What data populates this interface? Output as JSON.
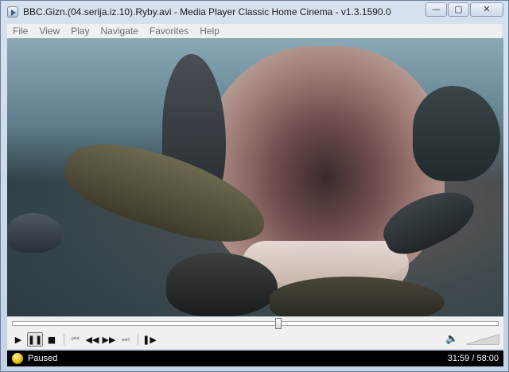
{
  "window": {
    "title": "BBC.Gizn.(04.serija.iz.10).Ryby.avi - Media Player Classic Home Cinema - v1.3.1590.0",
    "buttons": {
      "minimize": "—",
      "maximize": "▢",
      "close": "✕"
    }
  },
  "menu": {
    "items": [
      "File",
      "View",
      "Play",
      "Navigate",
      "Favorites",
      "Help"
    ]
  },
  "controls": {
    "seek_position_fraction": 0.548,
    "buttons": {
      "play": "▶",
      "pause": "❚❚",
      "stop": "■",
      "prev": "⏮",
      "rewind": "◀◀",
      "forward": "▶▶",
      "next": "⏭",
      "frame_step": "❚▶"
    },
    "speaker_icon": "speaker-icon",
    "volume_level_fraction": 1.0
  },
  "status": {
    "state": "Paused",
    "time": "31:59 / 58:00"
  },
  "colors": {
    "status_bg": "#000000",
    "status_text": "#ffffff",
    "panel_bg": "#f0f0f0"
  }
}
